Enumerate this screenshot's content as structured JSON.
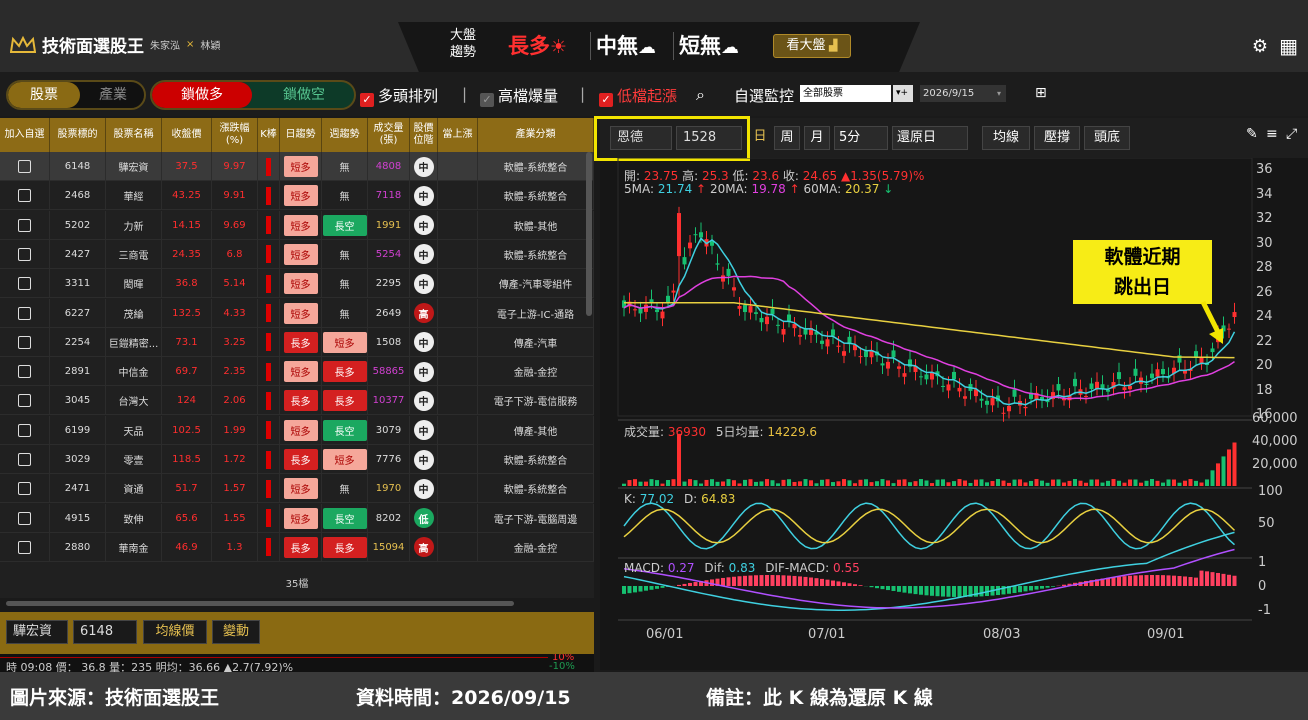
{
  "app": {
    "title": "技術面選股王",
    "author_a": "朱家泓",
    "author_x": "×",
    "author_b": "林穎"
  },
  "market": {
    "label_line1": "大盤",
    "label_line2": "趨勢",
    "long": "長多",
    "mid": "中無",
    "short": "短無",
    "view_button": "看大盤"
  },
  "mode_tabs": {
    "stock": "股票",
    "industry": "產業",
    "lock_long": "鎖做多",
    "lock_short": "鎖做空"
  },
  "filters": [
    {
      "label": "多頭排列",
      "checked": true,
      "color": "#ffffff"
    },
    {
      "label": "高檔爆量",
      "checked": true,
      "color": "#ffffff",
      "dim": true
    },
    {
      "label": "低檔起漲",
      "checked": true,
      "color": "#ff3b3b"
    }
  ],
  "watch": {
    "label": "自選監控",
    "select": "全部股票",
    "date": "2026/9/15"
  },
  "table": {
    "headers": [
      "加入自選",
      "股票標的",
      "股票名稱",
      "收盤價",
      "漲跌幅 (%)",
      "K棒",
      "日趨勢",
      "週趨勢",
      "成交量 (張)",
      "股價 位階",
      "當上漲",
      "產業分類"
    ],
    "rows": [
      {
        "code": "6148",
        "name": "驊宏資",
        "close": "37.5",
        "chg": "9.97",
        "d": "短多",
        "w": "無",
        "vol": "4808",
        "vc": "#d040d0",
        "pos": "中",
        "ind": "軟體-系統整合"
      },
      {
        "code": "2468",
        "name": "華經",
        "close": "43.25",
        "chg": "9.91",
        "d": "短多",
        "w": "無",
        "vol": "7118",
        "vc": "#d040d0",
        "pos": "中",
        "ind": "軟體-系統整合"
      },
      {
        "code": "5202",
        "name": "力新",
        "close": "14.15",
        "chg": "9.69",
        "d": "短多",
        "w": "長空",
        "vol": "1991",
        "vc": "#e6c050",
        "pos": "中",
        "ind": "軟體-其他"
      },
      {
        "code": "2427",
        "name": "三商電",
        "close": "24.35",
        "chg": "6.8",
        "d": "短多",
        "w": "無",
        "vol": "5254",
        "vc": "#d040d0",
        "pos": "中",
        "ind": "軟體-系統整合"
      },
      {
        "code": "3311",
        "name": "閎暉",
        "close": "36.8",
        "chg": "5.14",
        "d": "短多",
        "w": "無",
        "vol": "2295",
        "vc": "#dddddd",
        "pos": "中",
        "ind": "傳產-汽車零組件"
      },
      {
        "code": "6227",
        "name": "茂綸",
        "close": "132.5",
        "chg": "4.33",
        "d": "短多",
        "w": "無",
        "vol": "2649",
        "vc": "#dddddd",
        "pos": "高",
        "ind": "電子上游-IC-通路"
      },
      {
        "code": "2254",
        "name": "巨鎧精密...",
        "close": "73.1",
        "chg": "3.25",
        "d": "長多",
        "w": "短多",
        "vol": "1508",
        "vc": "#dddddd",
        "pos": "中",
        "ind": "傳產-汽車"
      },
      {
        "code": "2891",
        "name": "中信金",
        "close": "69.7",
        "chg": "2.35",
        "d": "短多",
        "w": "長多",
        "vol": "58865",
        "vc": "#d040d0",
        "pos": "中",
        "ind": "金融-金控"
      },
      {
        "code": "3045",
        "name": "台灣大",
        "close": "124",
        "chg": "2.06",
        "d": "長多",
        "w": "長多",
        "vol": "10377",
        "vc": "#d040d0",
        "pos": "中",
        "ind": "電子下游-電信服務"
      },
      {
        "code": "6199",
        "name": "天品",
        "close": "102.5",
        "chg": "1.99",
        "d": "短多",
        "w": "長空",
        "vol": "3079",
        "vc": "#dddddd",
        "pos": "中",
        "ind": "傳產-其他"
      },
      {
        "code": "3029",
        "name": "零壹",
        "close": "118.5",
        "chg": "1.72",
        "d": "長多",
        "w": "短多",
        "vol": "7776",
        "vc": "#dddddd",
        "pos": "中",
        "ind": "軟體-系統整合"
      },
      {
        "code": "2471",
        "name": "資通",
        "close": "51.7",
        "chg": "1.57",
        "d": "短多",
        "w": "無",
        "vol": "1970",
        "vc": "#e6c050",
        "pos": "中",
        "ind": "軟體-系統整合"
      },
      {
        "code": "4915",
        "name": "致伸",
        "close": "65.6",
        "chg": "1.55",
        "d": "短多",
        "w": "長空",
        "vol": "8202",
        "vc": "#dddddd",
        "pos": "低",
        "ind": "電子下游-電腦周邊"
      },
      {
        "code": "2880",
        "name": "華南金",
        "close": "46.9",
        "chg": "1.3",
        "d": "長多",
        "w": "長多",
        "vol": "15094",
        "vc": "#e6c050",
        "pos": "高",
        "ind": "金融-金控"
      }
    ],
    "count": "35檔"
  },
  "bottom_left": {
    "name": "驊宏資",
    "code": "6148",
    "avg_btn": "均線價",
    "change_btn": "變動",
    "pct_up": "10%",
    "pct_down": "-10%",
    "ticker": "時 09:08 價： 36.8 量：235 明均：36.66 ▲2.7(7.92)%"
  },
  "chart_toolbar": {
    "name": "恩德",
    "code": "1528",
    "day": "日",
    "week": "周",
    "month": "月",
    "interval": "5分",
    "restore": "還原日",
    "ma": "均線",
    "pressure": "壓撐",
    "top_bottom": "頭底"
  },
  "quote": {
    "open_l": "開:",
    "open": "23.75",
    "high_l": "高:",
    "high": "25.3",
    "low_l": "低:",
    "low": "23.6",
    "close_l": "收:",
    "close": "24.65",
    "chg": "▲1.35(5.79)%"
  },
  "ma": {
    "ma5_l": "5MA:",
    "ma5": "21.74",
    "ma20_l": "20MA:",
    "ma20": "19.78",
    "ma60_l": "60MA:",
    "ma60": "20.37"
  },
  "volume": {
    "label": "成交量:",
    "value": "36930",
    "avg_l": "5日均量:",
    "avg": "14229.6"
  },
  "kd": {
    "k_l": "K:",
    "k": "77.02",
    "d_l": "D:",
    "d": "64.83"
  },
  "macd": {
    "macd_l": "MACD:",
    "macd": "0.27",
    "dif_l": "Dif:",
    "dif": "0.83",
    "osc_l": "DIF-MACD:",
    "osc": "0.55"
  },
  "axis": {
    "price": [
      "36",
      "34",
      "32",
      "30",
      "28",
      "26",
      "24",
      "22",
      "20",
      "18",
      "16"
    ],
    "vol": [
      "60,000",
      "40,000",
      "20,000"
    ],
    "kd": [
      "100",
      "50"
    ],
    "macd": [
      "1",
      "0",
      "-1"
    ],
    "dates": [
      "06/01",
      "07/01",
      "08/03",
      "09/01"
    ]
  },
  "callout": {
    "line1": "軟體近期",
    "line2": "跳出日"
  },
  "footer": {
    "source": "圖片來源：技術面選股王",
    "time": "資料時間：2026/09/15",
    "note": "備註：此 K 線為還原 K 線"
  },
  "colors": {
    "up": "#ff2e2e",
    "down": "#16c070",
    "gold": "#8d6b16",
    "highlight": "#f2e400"
  }
}
